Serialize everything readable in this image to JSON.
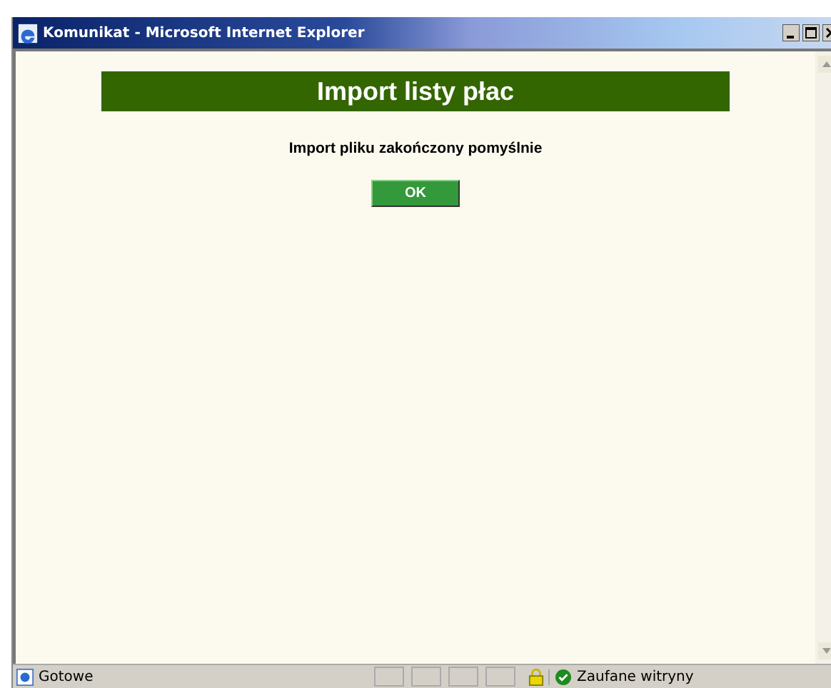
{
  "window": {
    "title": "Komunikat - Microsoft Internet Explorer"
  },
  "page": {
    "heading": "Import listy płac",
    "message": "Import pliku zakończony pomyślnie",
    "button": "OK"
  },
  "status_bar": {
    "text": "Gotowe",
    "zone": "Zaufane witryny"
  }
}
